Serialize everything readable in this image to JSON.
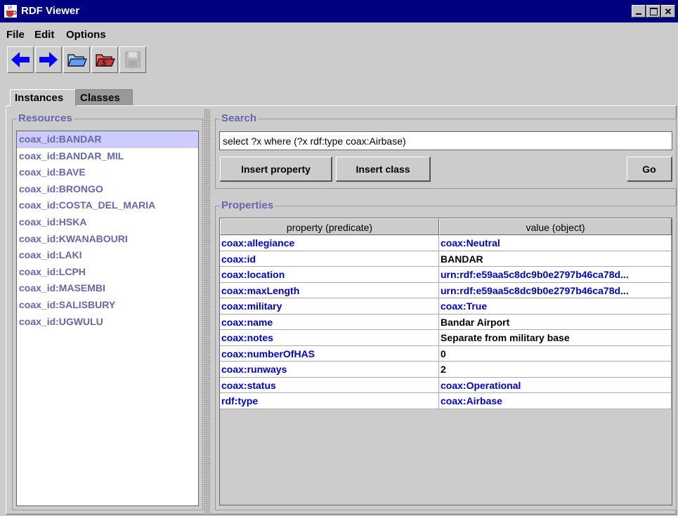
{
  "window": {
    "title": "RDF Viewer",
    "controls": [
      "minimize",
      "maximize",
      "close"
    ]
  },
  "menu": [
    "File",
    "Edit",
    "Options"
  ],
  "toolbar": [
    {
      "name": "back-arrow-icon",
      "color": "#0000ff"
    },
    {
      "name": "forward-arrow-icon",
      "color": "#0000ff"
    },
    {
      "name": "open-folder-icon",
      "color": "#6699ff"
    },
    {
      "name": "open-schema-icon",
      "color": "#cc3333"
    },
    {
      "name": "save-disk-icon",
      "color": "#999999"
    }
  ],
  "tabs": {
    "instances": "Instances",
    "classes": "Classes"
  },
  "resources": {
    "title": "Resources",
    "items": [
      "coax_id:BANDAR",
      "coax_id:BANDAR_MIL",
      "coax_id:BAVE",
      "coax_id:BRONGO",
      "coax_id:COSTA_DEL_MARIA",
      "coax_id:HSKA",
      "coax_id:KWANABOURI",
      "coax_id:LAKI",
      "coax_id:LCPH",
      "coax_id:MASEMBI",
      "coax_id:SALISBURY",
      "coax_id:UGWULU"
    ],
    "selected_index": 0
  },
  "search": {
    "title": "Search",
    "query": "select ?x where (?x rdf:type coax:Airbase)",
    "insert_property": "Insert property",
    "insert_class": "Insert class",
    "go": "Go"
  },
  "properties": {
    "title": "Properties",
    "columns": [
      "property (predicate)",
      "value (object)"
    ],
    "rows": [
      {
        "property": "coax:allegiance",
        "value": "coax:Neutral",
        "value_is_link": true
      },
      {
        "property": "coax:id",
        "value": "BANDAR",
        "value_is_link": false
      },
      {
        "property": "coax:location",
        "value": "urn:rdf:e59aa5c8dc9b0e2797b46ca78d...",
        "value_is_link": true
      },
      {
        "property": "coax:maxLength",
        "value": "urn:rdf:e59aa5c8dc9b0e2797b46ca78d...",
        "value_is_link": true
      },
      {
        "property": "coax:military",
        "value": "coax:True",
        "value_is_link": true
      },
      {
        "property": "coax:name",
        "value": "Bandar Airport",
        "value_is_link": false
      },
      {
        "property": "coax:notes",
        "value": "Separate from military base",
        "value_is_link": false
      },
      {
        "property": "coax:numberOfHAS",
        "value": "0",
        "value_is_link": false
      },
      {
        "property": "coax:runways",
        "value": "2",
        "value_is_link": false
      },
      {
        "property": "coax:status",
        "value": "coax:Operational",
        "value_is_link": true
      },
      {
        "property": "rdf:type",
        "value": "coax:Airbase",
        "value_is_link": true
      }
    ]
  }
}
